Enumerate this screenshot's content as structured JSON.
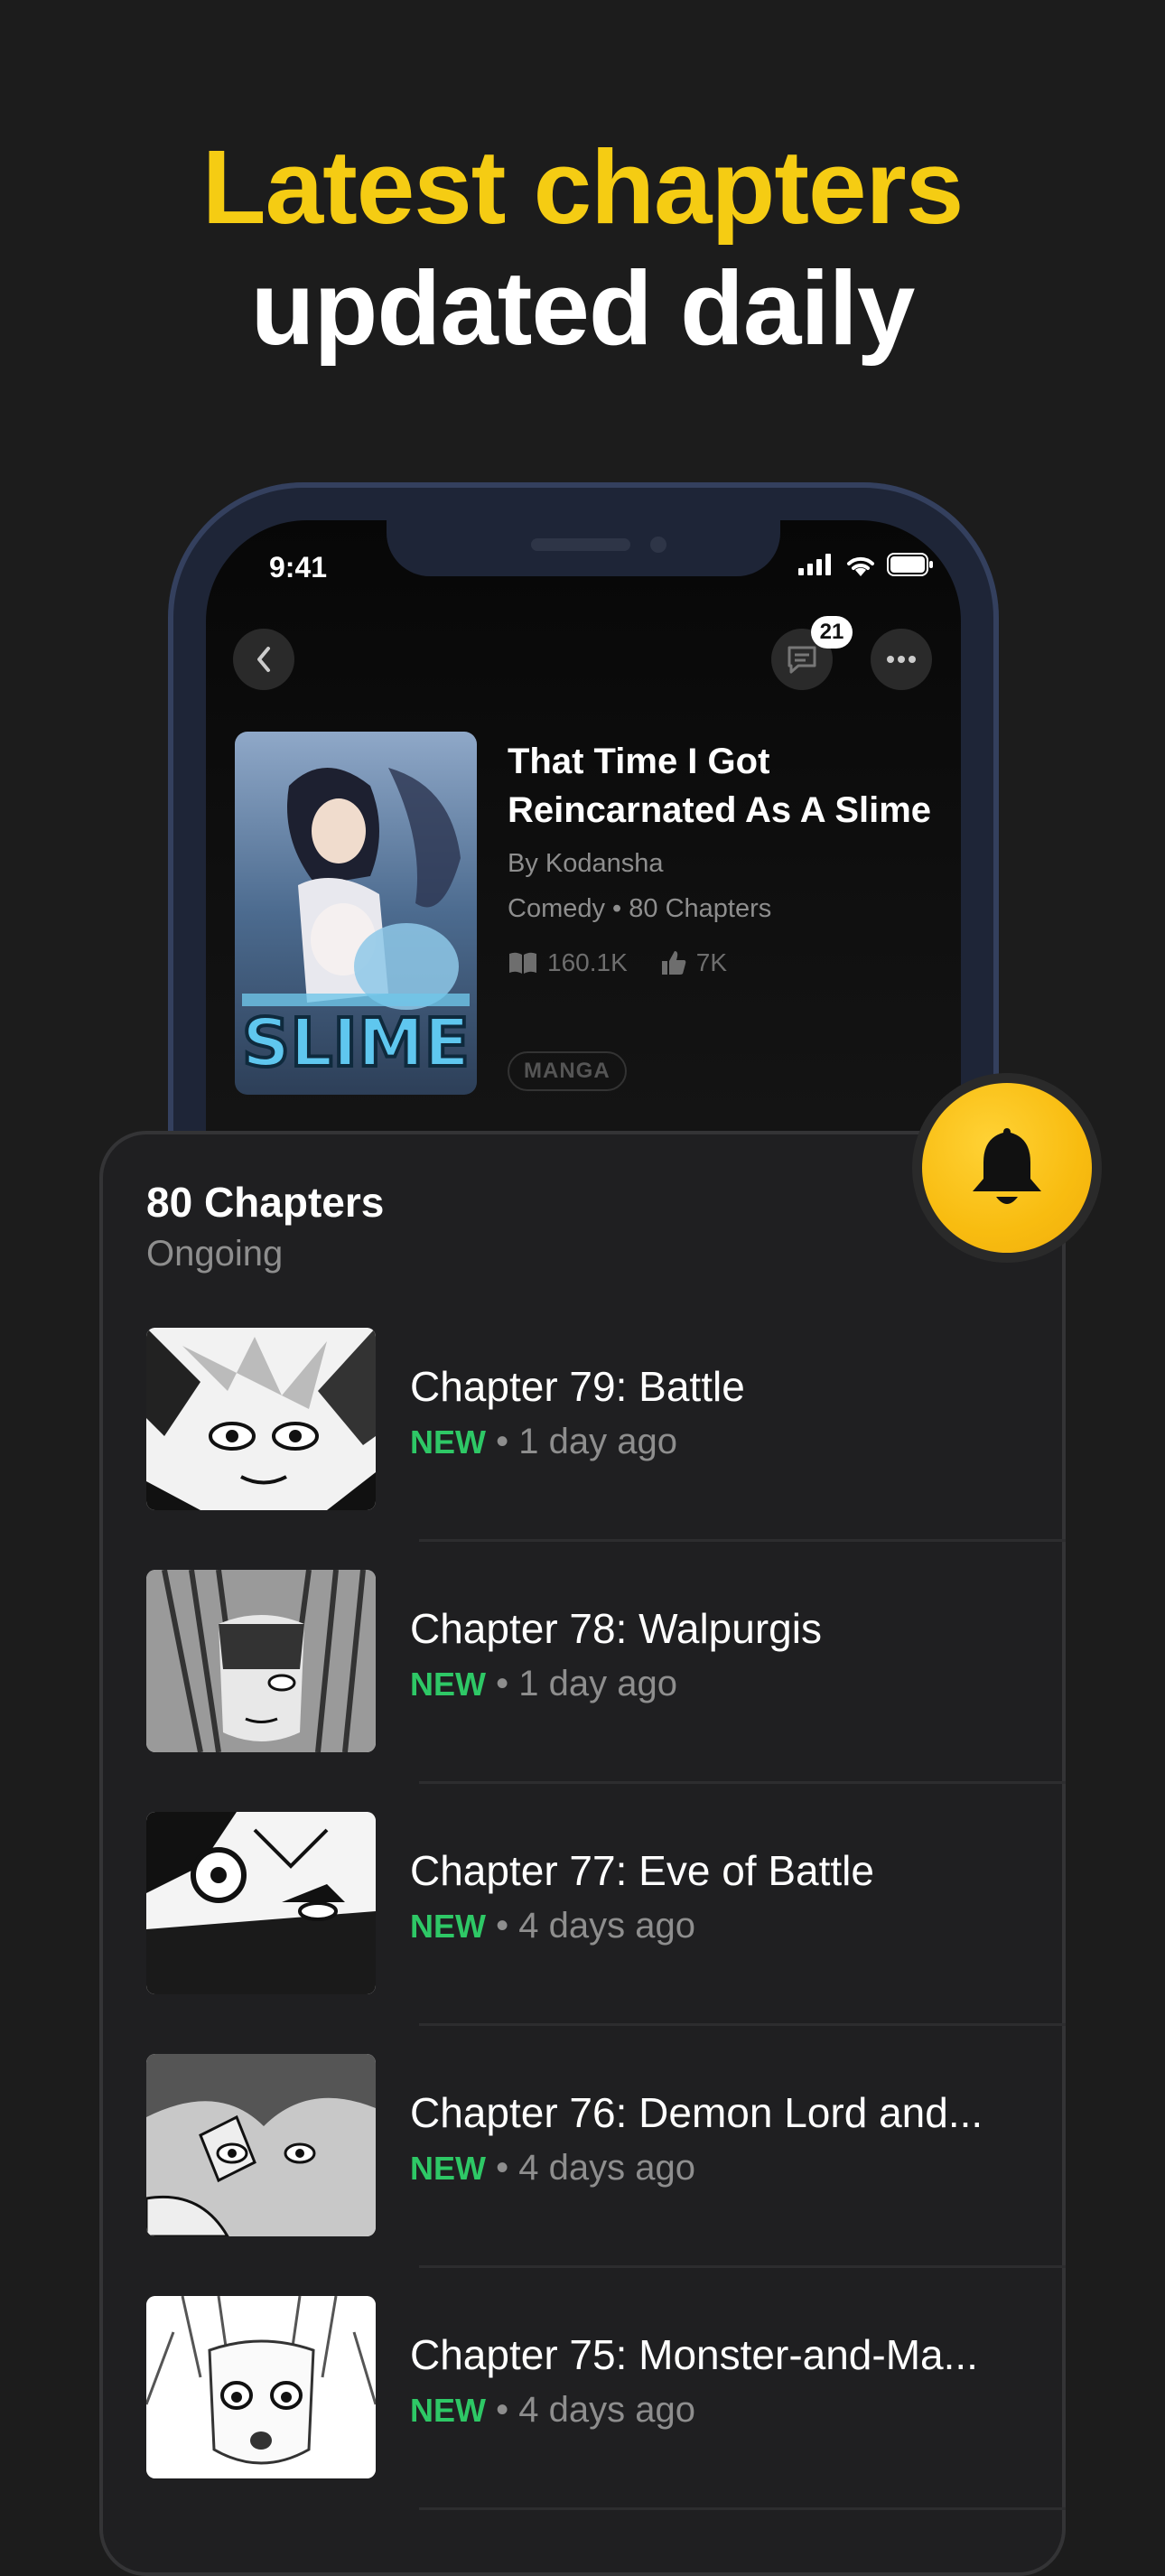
{
  "headline": {
    "line1": "Latest chapters",
    "line2": "updated daily"
  },
  "colors": {
    "accent_yellow": "#f5cc13",
    "new_green": "#2ec866",
    "background": "#1c1c1c"
  },
  "phone": {
    "time": "9:41",
    "status_icons": [
      "signal-icon",
      "wifi-icon",
      "battery-icon"
    ],
    "comment_count": "21",
    "manga": {
      "title": "That Time I Got Reincarnated As A Slime",
      "author": "By Kodansha",
      "meta": "Comedy • 80 Chapters",
      "reads": "160.1K",
      "likes": "7K",
      "tag": "MANGA"
    }
  },
  "panel": {
    "title": "80 Chapters",
    "status": "Ongoing",
    "chapters": [
      {
        "title": "Chapter 79: Battle",
        "badge": "NEW",
        "sep": "•",
        "time": "1 day ago"
      },
      {
        "title": "Chapter 78: Walpurgis",
        "badge": "NEW",
        "sep": "•",
        "time": "1 day ago"
      },
      {
        "title": "Chapter 77: Eve of Battle",
        "badge": "NEW",
        "sep": "•",
        "time": "4 days ago"
      },
      {
        "title": "Chapter 76: Demon Lord and...",
        "badge": "NEW",
        "sep": "•",
        "time": "4 days ago"
      },
      {
        "title": "Chapter 75: Monster-and-Ma...",
        "badge": "NEW",
        "sep": "•",
        "time": "4 days ago"
      }
    ]
  }
}
